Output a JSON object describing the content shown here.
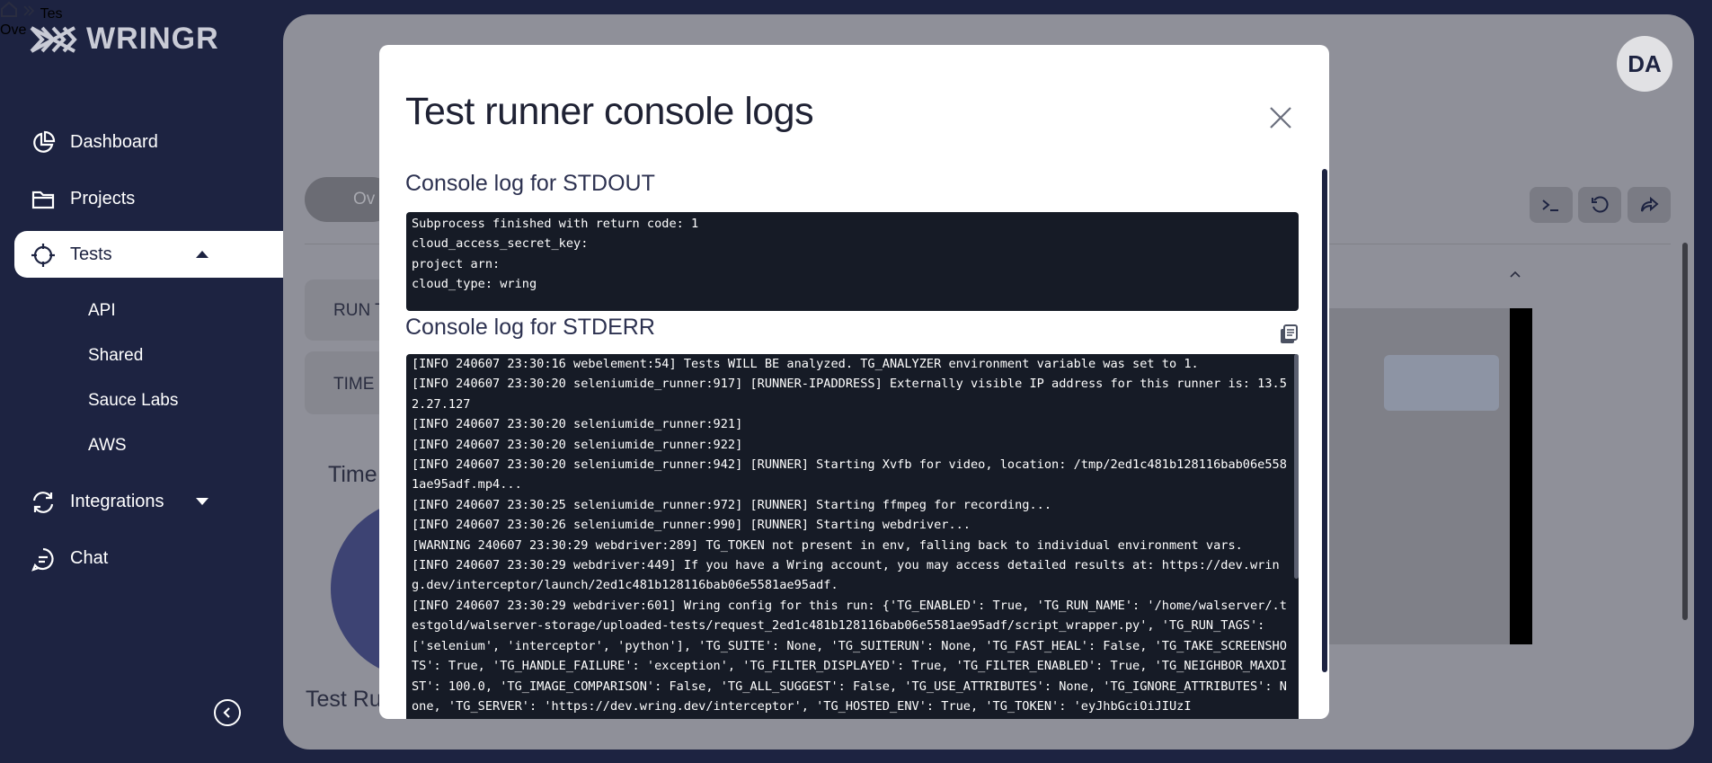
{
  "app": {
    "name": "WRINGR"
  },
  "sidebar": {
    "items": [
      {
        "label": "Dashboard"
      },
      {
        "label": "Projects"
      },
      {
        "label": "Tests"
      },
      {
        "label": "Integrations"
      },
      {
        "label": "Chat"
      }
    ],
    "tests_subitems": [
      "API",
      "Shared",
      "Sauce Labs",
      "AWS"
    ]
  },
  "header": {
    "breadcrumb_partial": "Tes",
    "title_partial": "Ove",
    "tab_partial": "Ov",
    "avatar_initials": "DA"
  },
  "cards": {
    "run_partial": "RUN T",
    "time_partial": "TIME",
    "timeline_partial": "Time",
    "test_runs_partial": "Test Ru"
  },
  "modal": {
    "title": "Test runner console logs",
    "stdout_title": "Console log for STDOUT",
    "stderr_title": "Console log for STDERR",
    "stdout_lines": [
      "Subprocess finished with return code: 1",
      "cloud_access_secret_key:",
      "project arn:",
      "cloud_type: wring"
    ],
    "stderr_lines": [
      "[INFO 240607 23:30:16 webelement:54] Tests WILL BE analyzed. TG_ANALYZER environment variable was set to 1.",
      "[INFO 240607 23:30:20 seleniumide_runner:917] [RUNNER-IPADDRESS] Externally visible IP address for this runner is: 13.52.27.127",
      "[INFO 240607 23:30:20 seleniumide_runner:921]",
      "[INFO 240607 23:30:20 seleniumide_runner:922]",
      "[INFO 240607 23:30:20 seleniumide_runner:942] [RUNNER] Starting Xvfb for video, location: /tmp/2ed1c481b128116bab06e5581ae95adf.mp4...",
      "[INFO 240607 23:30:25 seleniumide_runner:972] [RUNNER] Starting ffmpeg for recording...",
      "[INFO 240607 23:30:26 seleniumide_runner:990] [RUNNER] Starting webdriver...",
      "[WARNING 240607 23:30:29 webdriver:289] TG_TOKEN not present in env, falling back to individual environment vars.",
      "[INFO 240607 23:30:29 webdriver:449] If you have a Wring account, you may access detailed results at: https://dev.wring.dev/interceptor/launch/2ed1c481b128116bab06e5581ae95adf.",
      "[INFO 240607 23:30:29 webdriver:601] Wring config for this run: {'TG_ENABLED': True, 'TG_RUN_NAME': '/home/walserver/.testgold/walserver-storage/uploaded-tests/request_2ed1c481b128116bab06e5581ae95adf/script_wrapper.py', 'TG_RUN_TAGS': ['selenium', 'interceptor', 'python'], 'TG_SUITE': None, 'TG_SUITERUN': None, 'TG_FAST_HEAL': False, 'TG_TAKE_SCREENSHOTS': True, 'TG_HANDLE_FAILURE': 'exception', 'TG_FILTER_DISPLAYED': True, 'TG_FILTER_ENABLED': True, 'TG_NEIGHBOR_MAXDIST': 100.0, 'TG_IMAGE_COMPARISON': False, 'TG_ALL_SUGGEST': False, 'TG_USE_ATTRIBUTES': None, 'TG_IGNORE_ATTRIBUTES': None, 'TG_SERVER': 'https://dev.wring.dev/interceptor', 'TG_HOSTED_ENV': True, 'TG_TOKEN': 'eyJhbGciOiJIUzI"
    ]
  },
  "icons": {
    "logo": "wringr-logo-icon",
    "dashboard": "pie-chart-icon",
    "projects": "folder-icon",
    "tests": "crosshair-icon",
    "integrations": "sync-icon",
    "chat": "chat-icon",
    "close": "close-icon",
    "copy": "copy-icon",
    "terminal": "terminal-icon",
    "refresh": "refresh-icon",
    "share": "share-icon",
    "collapse": "chevron-left-icon"
  },
  "colors": {
    "sidebar_bg": "#1d2341",
    "console_bg": "#161b26",
    "modal_bg": "#ffffff"
  }
}
